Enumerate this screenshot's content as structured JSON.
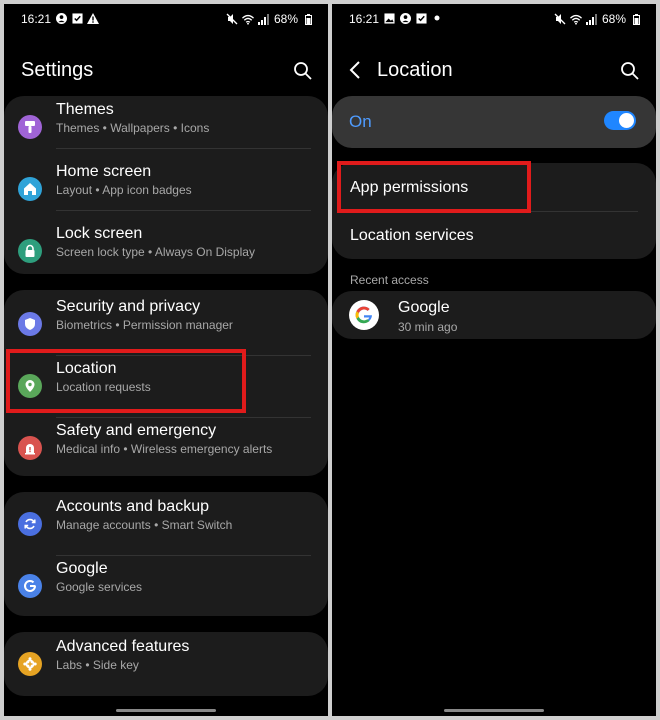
{
  "left": {
    "status": {
      "time": "16:21",
      "battery": "68%"
    },
    "title": "Settings",
    "groups": [
      [
        {
          "name": "Themes",
          "sub": "Themes • Wallpapers • Icons",
          "icon": "themes-icon",
          "color": "#a064d6"
        },
        {
          "name": "Home screen",
          "sub": "Layout • App icon badges",
          "icon": "home-icon",
          "color": "#2fa3d8"
        },
        {
          "name": "Lock screen",
          "sub": "Screen lock type • Always On Display",
          "icon": "lock-icon",
          "color": "#2e9e7d"
        }
      ],
      [
        {
          "name": "Security and privacy",
          "sub": "Biometrics • Permission manager",
          "icon": "shield-icon",
          "color": "#6b79e6"
        },
        {
          "name": "Location",
          "sub": "Location requests",
          "icon": "location-pin-icon",
          "color": "#5aa75a"
        },
        {
          "name": "Safety and emergency",
          "sub": "Medical info • Wireless emergency alerts",
          "icon": "emergency-icon",
          "color": "#d9534f"
        }
      ],
      [
        {
          "name": "Accounts and backup",
          "sub": "Manage accounts • Smart Switch",
          "icon": "sync-icon",
          "color": "#4a6fe0"
        },
        {
          "name": "Google",
          "sub": "Google services",
          "icon": "google-g-icon",
          "color": "#4a82e8"
        }
      ],
      [
        {
          "name": "Advanced features",
          "sub": "Labs • Side key",
          "icon": "gear-plus-icon",
          "color": "#e6a323"
        }
      ]
    ]
  },
  "right": {
    "status": {
      "time": "16:21",
      "battery": "68%"
    },
    "title": "Location",
    "master": {
      "label": "On",
      "enabled": true
    },
    "menu": {
      "app_permissions": "App permissions",
      "location_services": "Location services"
    },
    "recent_label": "Recent access",
    "recent": [
      {
        "name": "Google",
        "time": "30 min ago",
        "icon": "google-logo-icon"
      }
    ]
  },
  "colors": {
    "highlight": "#e01b1b",
    "accent": "#1f86ff",
    "on_text": "#4f9cff"
  }
}
